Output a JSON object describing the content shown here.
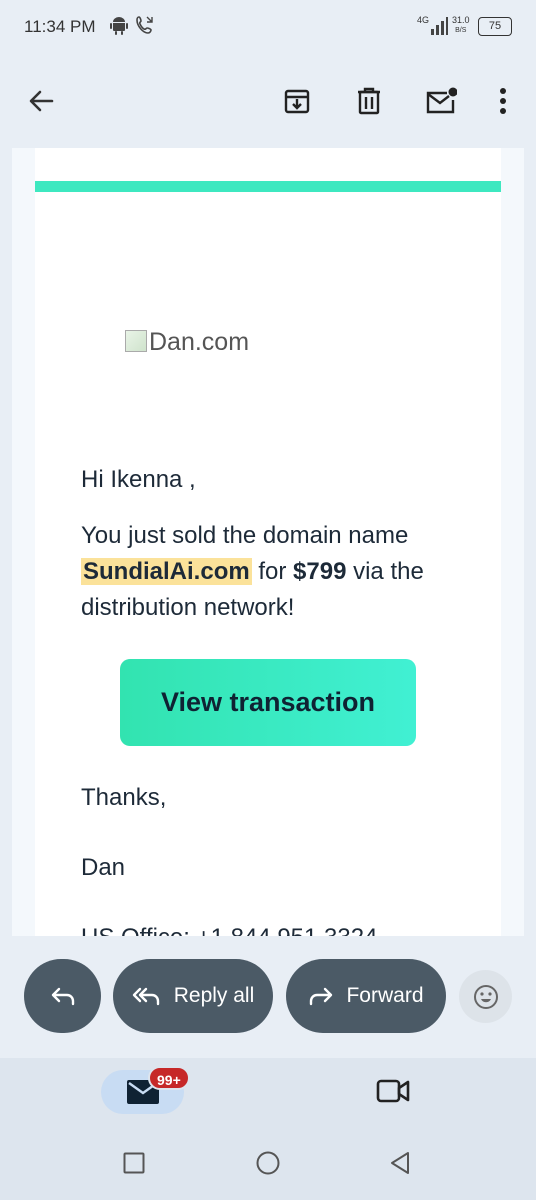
{
  "status": {
    "time": "11:34 PM",
    "network": "4G",
    "speed_value": "31.0",
    "speed_unit": "B/S",
    "battery": "75"
  },
  "toolbar": {
    "back_icon": "arrow-left-icon",
    "archive_icon": "archive-icon",
    "delete_icon": "trash-icon",
    "mark_unread_icon": "mail-dot-icon",
    "more_icon": "more-vert-icon"
  },
  "email": {
    "accent_color": "#3ee8c0",
    "logo_alt": "Dan.com",
    "greeting": "Hi Ikenna ,",
    "line_prefix": "You just sold the domain name ",
    "domain": "SundialAi.com",
    "line_mid": " for ",
    "price": "$799",
    "line_suffix": " via the distribution network!",
    "cta_label": "View transaction",
    "thanks": "Thanks,",
    "signature": "Dan",
    "office_line": "US Office: +1 844 951 3324"
  },
  "actions": {
    "reply_icon": "reply-icon",
    "reply_all_label": "Reply all",
    "forward_label": "Forward",
    "emoji_icon": "emoji-icon"
  },
  "bottom_nav": {
    "mail_badge": "99+",
    "mail_icon": "mail-icon",
    "meet_icon": "video-icon"
  },
  "system_nav": {
    "recents_icon": "square-icon",
    "home_icon": "circle-icon",
    "back_icon": "triangle-back-icon"
  }
}
